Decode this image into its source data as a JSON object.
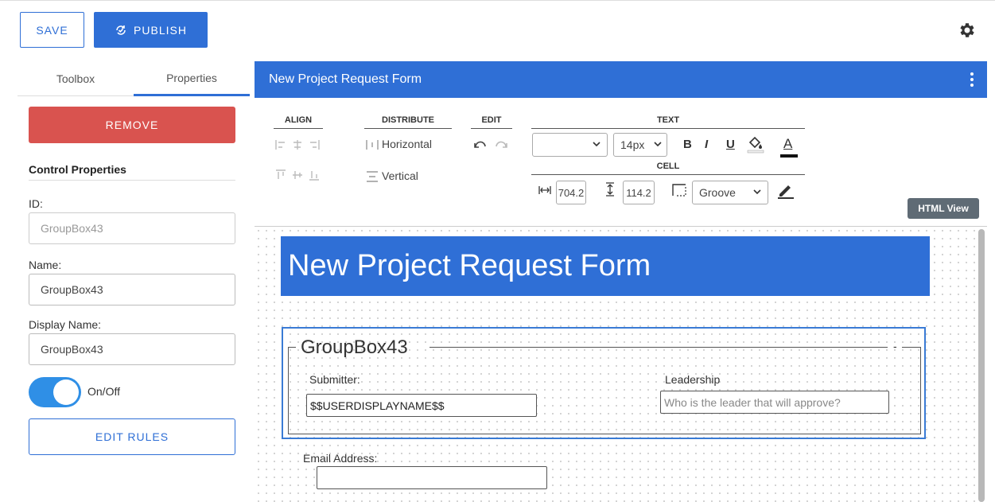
{
  "toolbar": {
    "save_label": "SAVE",
    "publish_label": "PUBLISH"
  },
  "left_panel": {
    "tabs": [
      {
        "label": "Toolbox",
        "active": false
      },
      {
        "label": "Properties",
        "active": true
      }
    ],
    "remove_label": "REMOVE",
    "section_title": "Control Properties",
    "id_label": "ID:",
    "id_value": "GroupBox43",
    "name_label": "Name:",
    "name_value": "GroupBox43",
    "display_name_label": "Display Name:",
    "display_name_value": "GroupBox43",
    "toggle_label": "On/Off",
    "toggle_on": true,
    "edit_rules_label": "EDIT RULES"
  },
  "editor": {
    "title": "New Project Request Form",
    "groups": {
      "align": "ALIGN",
      "distribute": "DISTRIBUTE",
      "edit": "EDIT",
      "text": "TEXT",
      "cell": "CELL"
    },
    "distribute_horizontal": "Horizontal",
    "distribute_vertical": "Vertical",
    "font_size": "14px",
    "format_bold": "B",
    "format_italic": "I",
    "format_underline": "U",
    "format_color": "A",
    "cell_width": "704.2",
    "cell_height": "114.2",
    "border_style": "Groove",
    "html_view_label": "HTML View"
  },
  "form": {
    "banner_title": "New Project Request Form",
    "groupbox_title": "GroupBox43",
    "groupbox_min": "-",
    "submitter_label": "Submitter:",
    "submitter_value": "$$USERDISPLAYNAME$$",
    "leadership_label": "Leadership",
    "leadership_placeholder": "Who is the leader that will approve?",
    "email_label": "Email Address:"
  },
  "colors": {
    "primary": "#2f6fd6",
    "danger": "#d9534f",
    "toggle": "#2f8fe6"
  }
}
